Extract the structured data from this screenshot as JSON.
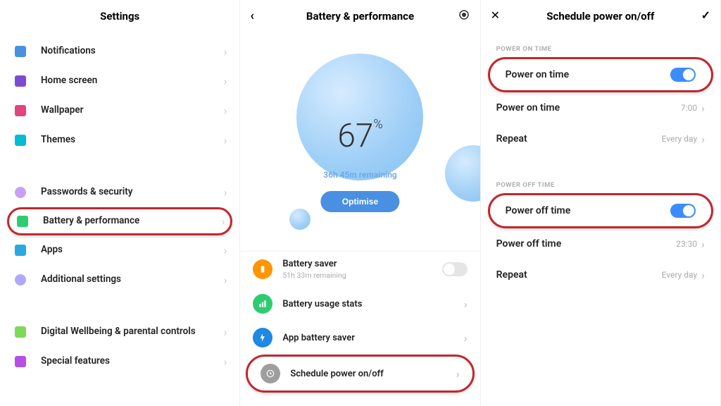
{
  "panel1": {
    "title": "Settings",
    "items": [
      {
        "label": "Notifications",
        "icon_color": "#4a90e2"
      },
      {
        "label": "Home screen",
        "icon_color": "#7b4bd6"
      },
      {
        "label": "Wallpaper",
        "icon_color": "#e0457e"
      },
      {
        "label": "Themes",
        "icon_color": "#00bcd4"
      }
    ],
    "items2": [
      {
        "label": "Passwords & security",
        "icon_color": "#c9a0f5"
      },
      {
        "label": "Battery & performance",
        "icon_color": "#2ecc71",
        "highlight": true
      },
      {
        "label": "Apps",
        "icon_color": "#2aa9e0"
      },
      {
        "label": "Additional settings",
        "icon_color": "#b0a8ff"
      }
    ],
    "items3": [
      {
        "label": "Digital Wellbeing & parental controls",
        "icon_color": "#7ed957"
      },
      {
        "label": "Special features",
        "icon_color": "#b84ee8"
      }
    ]
  },
  "panel2": {
    "title": "Battery & performance",
    "percent": "67",
    "percent_suffix": "%",
    "remaining": "36h 45m remaining",
    "optimise": "Optimise",
    "options": [
      {
        "label": "Battery saver",
        "sub": "51h 33m remaining",
        "color": "#ff9500",
        "toggle": "off"
      },
      {
        "label": "Battery usage stats",
        "color": "#2ecc71"
      },
      {
        "label": "App battery saver",
        "color": "#1e88e5"
      },
      {
        "label": "Schedule power on/off",
        "color": "#9e9e9e",
        "highlight": true
      }
    ]
  },
  "panel3": {
    "title": "Schedule power on/off",
    "sections": {
      "on": {
        "head": "POWER ON TIME",
        "toggle_label": "Power on time",
        "time_label": "Power on time",
        "time_value": "7:00",
        "repeat_label": "Repeat",
        "repeat_value": "Every day"
      },
      "off": {
        "head": "POWER OFF TIME",
        "toggle_label": "Power off time",
        "time_label": "Power off time",
        "time_value": "23:30",
        "repeat_label": "Repeat",
        "repeat_value": "Every day"
      }
    }
  }
}
